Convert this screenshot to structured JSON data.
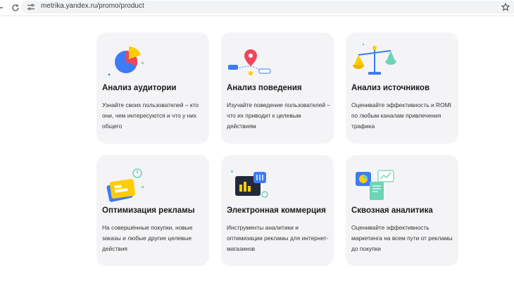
{
  "browser": {
    "url": "metrika.yandex.ru/promo/product"
  },
  "cards": [
    {
      "title": "Анализ аудитории",
      "description": "Узнайте своих пользователей – кто они, чем интересуются и что у них общего"
    },
    {
      "title": "Анализ поведения",
      "description": "Изучайте поведение пользователей – что их приводит к целевым действиям"
    },
    {
      "title": "Анализ источников",
      "description": "Оценивайте эффективность и ROMI по любым каналам привлечения трафика"
    },
    {
      "title": "Оптимизация рекламы",
      "description": "На совершённые покупки, новые заказы и любые другие целевые действия"
    },
    {
      "title": "Электронная коммерция",
      "description": "Инструменты аналитики и оптимизации рекламы для интернет-магазинов"
    },
    {
      "title": "Сквозная аналитика",
      "description": "Оценивайте эффективность маркетинга на всем пути от рекламы до покупки"
    }
  ],
  "colors": {
    "card_bg": "#f4f4f6",
    "accent_blue": "#3d7bf7",
    "accent_yellow": "#ffcc00",
    "accent_red": "#f0455a",
    "accent_green": "#6fd3b5"
  }
}
